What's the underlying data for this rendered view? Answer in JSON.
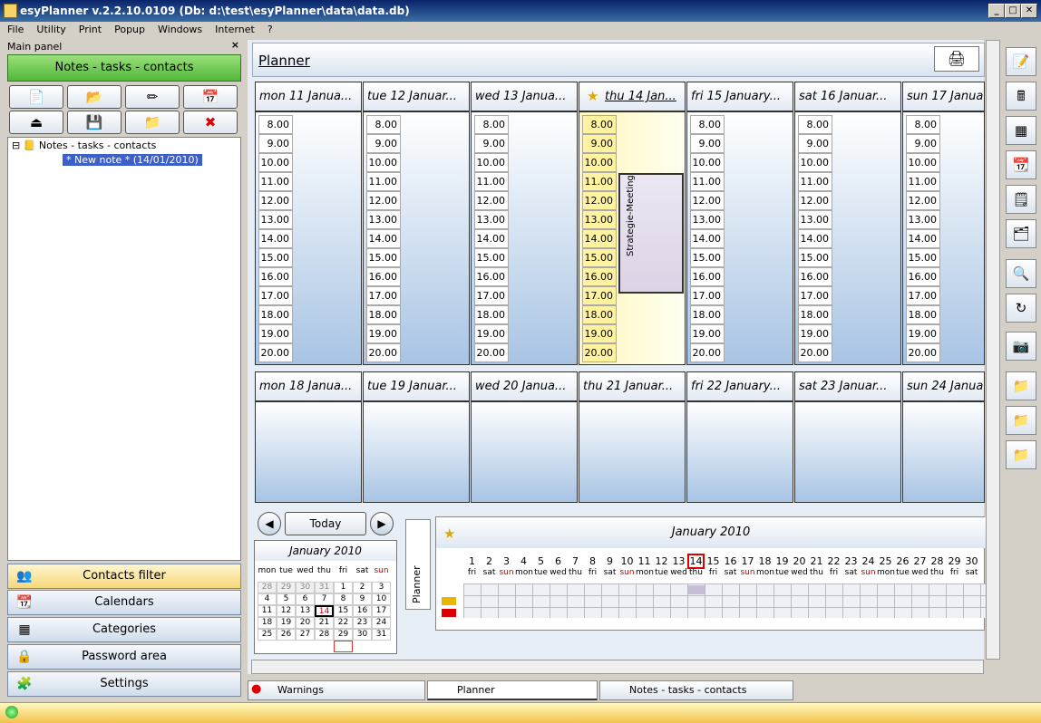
{
  "window": {
    "title": "esyPlanner v.2.2.10.0109 (Db: d:\\test\\esyPlanner\\data\\data.db)",
    "minimize": "_",
    "maximize": "□",
    "close": "✕"
  },
  "menu": [
    "File",
    "Utility",
    "Print",
    "Popup",
    "Windows",
    "Internet",
    "?"
  ],
  "main_panel": {
    "title": "Main panel",
    "close": "×",
    "header_button": "Notes - tasks - contacts",
    "tree": {
      "root": "Notes - tasks - contacts",
      "child": "* New note * (14/01/2010)"
    },
    "buttons": [
      {
        "label": "Contacts filter",
        "icon": "contacts-icon"
      },
      {
        "label": "Calendars",
        "icon": "calendar-icon"
      },
      {
        "label": "Categories",
        "icon": "categories-icon"
      },
      {
        "label": "Password area",
        "icon": "lock-icon"
      },
      {
        "label": "Settings",
        "icon": "puzzle-icon"
      }
    ]
  },
  "planner": {
    "title": "Planner",
    "hours": [
      "8.00",
      "9.00",
      "10.00",
      "11.00",
      "12.00",
      "13.00",
      "14.00",
      "15.00",
      "16.00",
      "17.00",
      "18.00",
      "19.00",
      "20.00"
    ],
    "week1": [
      "mon 11 Janua...",
      "tue 12 Januar...",
      "wed 13 Janua...",
      "thu 14 Jan...",
      "fri 15 January...",
      "sat 16 Januar...",
      "sun 17 Janua"
    ],
    "week2": [
      "mon 18 Janua...",
      "tue 19 Januar...",
      "wed 20 Janua...",
      "thu 21 Januar...",
      "fri 22 January...",
      "sat 23 Januar...",
      "sun 24 Janua"
    ],
    "event": "Strategie-Meeting",
    "today_button": "Today",
    "side_tab": "Planner"
  },
  "mini_calendar": {
    "month": "January 2010",
    "dow": [
      "mon",
      "tue",
      "wed",
      "thu",
      "fri",
      "sat",
      "sun"
    ],
    "days": [
      [
        "28",
        "29",
        "30",
        "31",
        "1",
        "2",
        "3"
      ],
      [
        "4",
        "5",
        "6",
        "7",
        "8",
        "9",
        "10"
      ],
      [
        "11",
        "12",
        "13",
        "14",
        "15",
        "16",
        "17"
      ],
      [
        "18",
        "19",
        "20",
        "21",
        "22",
        "23",
        "24"
      ],
      [
        "25",
        "26",
        "27",
        "28",
        "29",
        "30",
        "31"
      ]
    ]
  },
  "month_strip": {
    "title": "January 2010",
    "days": [
      "1",
      "2",
      "3",
      "4",
      "5",
      "6",
      "7",
      "8",
      "9",
      "10",
      "11",
      "12",
      "13",
      "14",
      "15",
      "16",
      "17",
      "18",
      "19",
      "20",
      "21",
      "22",
      "23",
      "24",
      "25",
      "26",
      "27",
      "28",
      "29",
      "30"
    ],
    "weekdays": [
      "fri",
      "sat",
      "sun",
      "mon",
      "tue",
      "wed",
      "thu",
      "fri",
      "sat",
      "sun",
      "mon",
      "tue",
      "wed",
      "thu",
      "fri",
      "sat",
      "sun",
      "mon",
      "tue",
      "wed",
      "thu",
      "fri",
      "sat",
      "sun",
      "mon",
      "tue",
      "wed",
      "thu",
      "fri",
      "sat"
    ]
  },
  "bottom_tabs": [
    "Warnings",
    "Planner",
    "Notes - tasks - contacts"
  ],
  "colors": {
    "accent_green": "#52b83a",
    "today_yellow": "#fff7c0",
    "event_purple": "#dcd3e6"
  }
}
